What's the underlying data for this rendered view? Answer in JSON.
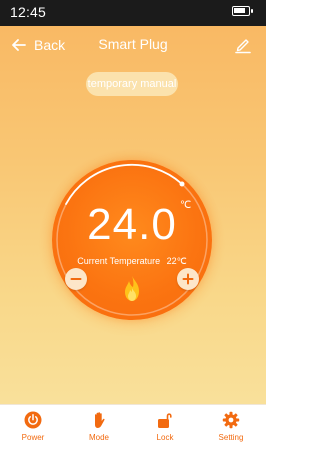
{
  "status_bar": {
    "time": "12:45",
    "battery_icon": "battery-icon",
    "battery_level": 0.8
  },
  "header": {
    "back_label": "Back",
    "title": "Smart Plug",
    "back_icon": "arrow-left-icon",
    "edit_icon": "pencil-icon"
  },
  "mode": {
    "label": "temporary manual"
  },
  "thermostat": {
    "set_temperature": "24.0",
    "unit": "℃",
    "current_label": "Current Temperature",
    "current_value": "22℃",
    "heating_icon": "flame-icon",
    "decrease_icon": "minus-icon",
    "increase_icon": "plus-icon"
  },
  "bottom_nav": {
    "items": [
      {
        "label": "Power",
        "icon": "power-icon"
      },
      {
        "label": "Mode",
        "icon": "hand-icon"
      },
      {
        "label": "Lock",
        "icon": "unlock-icon"
      },
      {
        "label": "Setting",
        "icon": "gear-icon"
      }
    ]
  },
  "colors": {
    "accent": "#F26A10",
    "dial": "#FB7411",
    "background_top": "#F9B661",
    "background_bottom": "#F9E4A2",
    "status_bar": "#1B1B1B"
  }
}
